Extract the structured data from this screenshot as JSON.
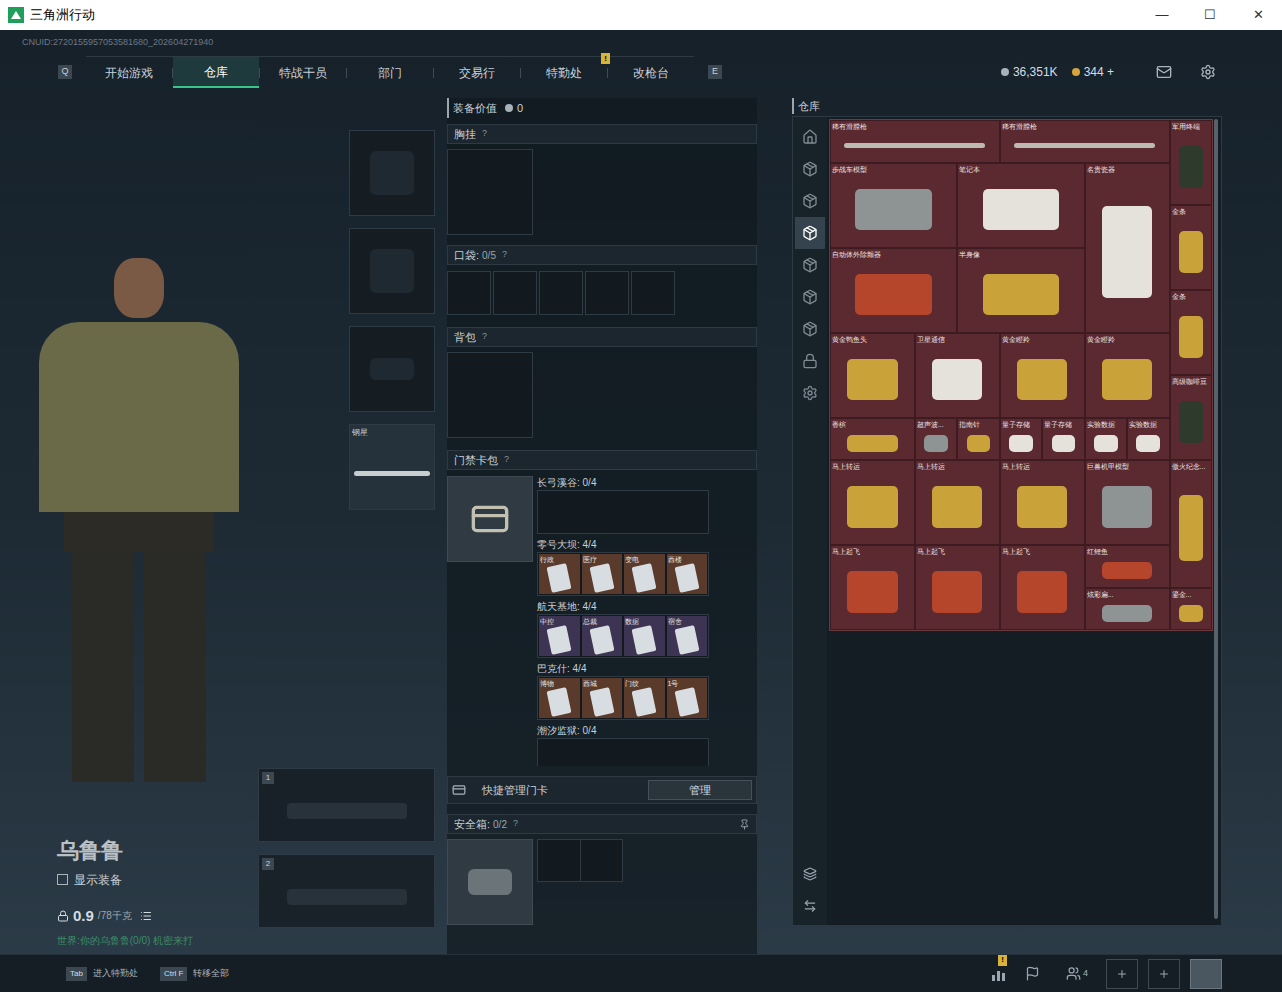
{
  "window": {
    "title": "三角洲行动",
    "controls": [
      "—",
      "☐",
      "✕"
    ]
  },
  "uid": "CNUID:2720155957053581680_202604271940",
  "nav": {
    "left_key": "Q",
    "right_key": "E",
    "tabs": [
      {
        "label": "开始游戏",
        "selected": false,
        "badge": ""
      },
      {
        "label": "仓库",
        "selected": true,
        "badge": ""
      },
      {
        "label": "特战干员",
        "selected": false,
        "badge": ""
      },
      {
        "label": "部门",
        "selected": false,
        "badge": ""
      },
      {
        "label": "交易行",
        "selected": false,
        "badge": ""
      },
      {
        "label": "特勤处",
        "selected": false,
        "badge": "!"
      },
      {
        "label": "改枪台",
        "selected": false,
        "badge": ""
      }
    ]
  },
  "currency": [
    {
      "value": "36,351K",
      "kind": "silver"
    },
    {
      "value": "344 +",
      "kind": "gold"
    }
  ],
  "character": {
    "name": "乌鲁鲁",
    "show_gear": {
      "label": "显示装备",
      "checked": false
    },
    "weight": "0.9",
    "capacity": "/78千克",
    "status": "世界:你的乌鲁鲁(0/0) 机密来打"
  },
  "gear_slots": [
    {
      "label": "",
      "kind": "helmet"
    },
    {
      "label": "",
      "kind": "armor"
    },
    {
      "label": "",
      "kind": "pistol"
    },
    {
      "label": "钢星",
      "kind": "melee"
    }
  ],
  "weapon_slots": [
    "1",
    "2"
  ],
  "loadout": {
    "value_label": "装备价值",
    "value": "0",
    "help": "?",
    "chest": "胸挂",
    "pockets": {
      "label": "口袋:",
      "count": "0/5"
    },
    "backpack": "背包",
    "keycard": "门禁卡包",
    "maps": [
      {
        "name": "长弓溪谷: 0/4",
        "color": "#4a3a2c",
        "cards": []
      },
      {
        "name": "零号大坝: 4/4",
        "color": "#5a3a2a",
        "cards": [
          "行政",
          "医疗",
          "变电",
          "西楼"
        ]
      },
      {
        "name": "航天基地: 4/4",
        "color": "#3c3452",
        "cards": [
          "中控",
          "总裁",
          "数据",
          "宿舍"
        ]
      },
      {
        "name": "巴克什: 4/4",
        "color": "#5a3a2a",
        "cards": [
          "博物",
          "西城",
          "门纹",
          "1号"
        ]
      },
      {
        "name": "潮汐监狱: 0/4",
        "color": "#4a3a2c",
        "cards": []
      }
    ],
    "quick_manage": "快捷管理门卡",
    "manage_button": "管理",
    "safe": {
      "label": "安全箱:",
      "count": "0/2"
    }
  },
  "stash": {
    "title": "仓库",
    "tabs": [
      {
        "kind": "home",
        "selected": false
      },
      {
        "kind": "box",
        "selected": false
      },
      {
        "kind": "box",
        "selected": false
      },
      {
        "kind": "box",
        "selected": true
      },
      {
        "kind": "box",
        "selected": false
      },
      {
        "kind": "box",
        "selected": false
      },
      {
        "kind": "box",
        "selected": false
      },
      {
        "kind": "lock",
        "selected": false
      },
      {
        "kind": "gear",
        "selected": false
      }
    ],
    "items": [
      {
        "name": "稀有滑膛枪",
        "kind": "gun"
      },
      {
        "name": "稀有滑膛枪",
        "kind": "gun"
      },
      {
        "name": "军用终端",
        "kind": "dark"
      },
      {
        "name": "步战车模型",
        "kind": "silver"
      },
      {
        "name": "笔记本",
        "kind": "white"
      },
      {
        "name": "名贵瓷器",
        "kind": "white"
      },
      {
        "name": "金条",
        "kind": "gold"
      },
      {
        "name": "金条",
        "kind": "gold"
      },
      {
        "name": "自动体外除颤器",
        "kind": "red"
      },
      {
        "name": "半身像",
        "kind": "gold"
      },
      {
        "name": "黄金鸭鱼头",
        "kind": "gold"
      },
      {
        "name": "卫星通信",
        "kind": "white"
      },
      {
        "name": "黄金瞪羚",
        "kind": "gold"
      },
      {
        "name": "黄金瞪羚",
        "kind": "gold"
      },
      {
        "name": "高级咖啡豆",
        "kind": "dark"
      },
      {
        "name": "香槟",
        "kind": "gold"
      },
      {
        "name": "超声波...",
        "kind": "silver"
      },
      {
        "name": "指南针",
        "kind": "gold"
      },
      {
        "name": "量子存储",
        "kind": "white"
      },
      {
        "name": "量子存储",
        "kind": "white"
      },
      {
        "name": "实验数据",
        "kind": "white"
      },
      {
        "name": "实验数据",
        "kind": "white"
      },
      {
        "name": "马上转运",
        "kind": "gold"
      },
      {
        "name": "马上转运",
        "kind": "gold"
      },
      {
        "name": "马上转运",
        "kind": "gold"
      },
      {
        "name": "巨兽机甲模型",
        "kind": "silver"
      },
      {
        "name": "傲火纪念...",
        "kind": "gold"
      },
      {
        "name": "马上起飞",
        "kind": "red"
      },
      {
        "name": "马上起飞",
        "kind": "red"
      },
      {
        "name": "马上起飞",
        "kind": "red"
      },
      {
        "name": "红鲤鱼",
        "kind": "red"
      },
      {
        "name": "炫彩扁...",
        "kind": "silver"
      },
      {
        "name": "鎏金...",
        "kind": "gold"
      }
    ]
  },
  "bottom": {
    "hints": [
      {
        "key": "Tab",
        "label": "进入特勤处"
      },
      {
        "key": "Ctrl F",
        "label": "转移全部"
      }
    ],
    "alert_badge": "!",
    "party_count": "4"
  }
}
